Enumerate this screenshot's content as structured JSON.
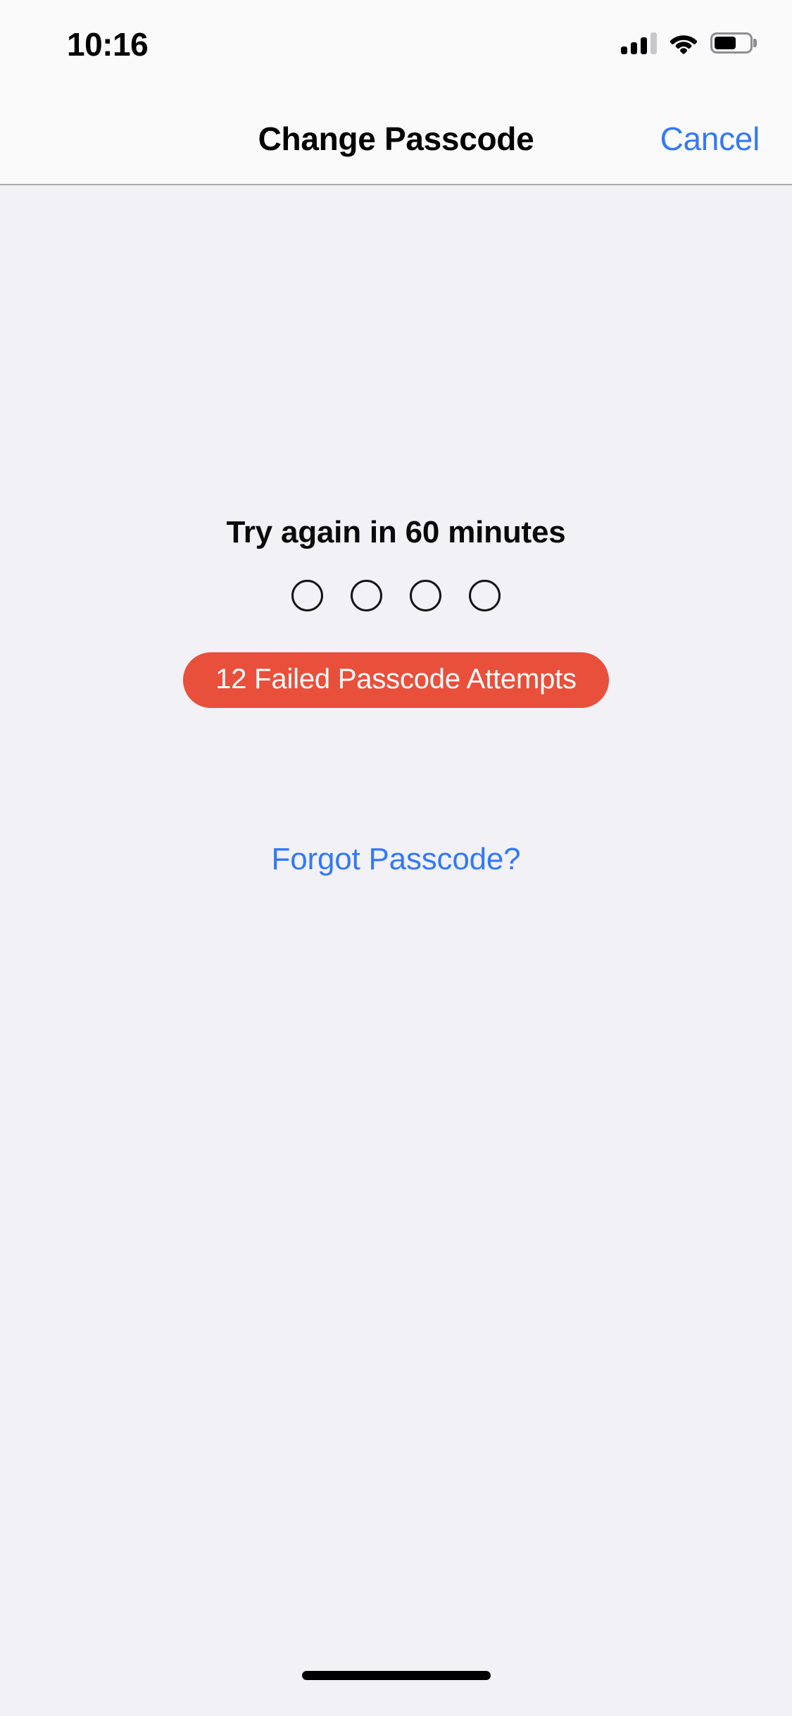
{
  "status_bar": {
    "time": "10:16",
    "signal_icon": "cellular-signal-icon",
    "signal_bars_total": 4,
    "signal_bars_active": 3,
    "wifi_icon": "wifi-icon",
    "wifi_strength": "full",
    "battery_icon": "battery-icon",
    "battery_percent": 62
  },
  "nav_bar": {
    "title": "Change Passcode",
    "cancel_label": "Cancel"
  },
  "main": {
    "prompt_title": "Try again in 60 minutes",
    "passcode_dots": {
      "count": 4,
      "filled": 0
    },
    "attempts_badge": {
      "label": "12 Failed Passcode Attempts",
      "failed_count": 12
    },
    "forgot_link_label": "Forgot Passcode?"
  },
  "home_indicator": {
    "name": "home-indicator"
  },
  "colors": {
    "accent_blue": "#3478F6",
    "error_red": "#E8503C",
    "background": "#F2F1F6",
    "bar_background": "#FAFAFB",
    "separator": "#A9A8AE",
    "text_primary": "#0A0A0A",
    "dot_stroke": "#141414"
  }
}
